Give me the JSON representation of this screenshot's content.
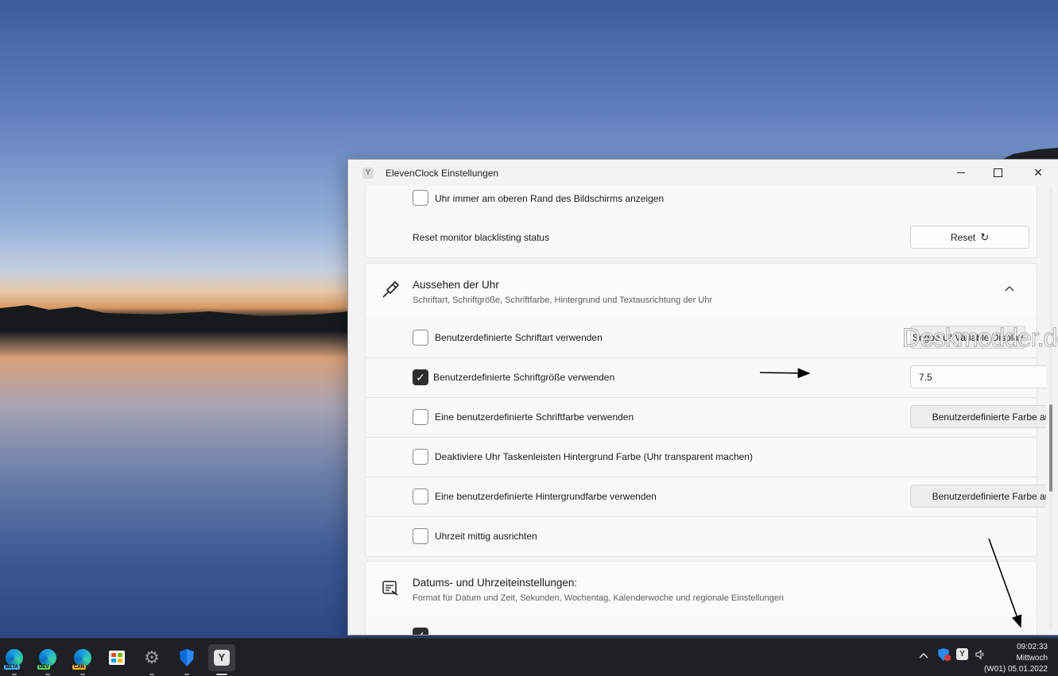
{
  "window": {
    "title": "ElevenClock Einstellungen",
    "app_icon_glyph": "Y"
  },
  "rows_top": [
    {
      "label": "Uhr immer am oberen Rand des Bildschirms anzeigen",
      "checked": false
    },
    {
      "label": "Reset monitor blacklisting status",
      "button": "Reset",
      "button_icon": "↻"
    }
  ],
  "section_appearance": {
    "title": "Aussehen der Uhr",
    "subtitle": "Schriftart, Schriftgröße, Schriftfarbe, Hintergrund und Textausrichtung der Uhr",
    "icon": "brush-icon",
    "collapse_glyph": "︿"
  },
  "appearance_rows": [
    {
      "label": "Benutzerdefinierte Schriftart verwenden",
      "checked": false,
      "button": "Segoe UI Variable Display"
    },
    {
      "label": "Benutzerdefinierte Schriftgröße verwenden",
      "checked": true,
      "select_value": "7.5"
    },
    {
      "label": "Eine benutzerdefinierte Schriftfarbe verwenden",
      "checked": false,
      "button": "Benutzerdefinierte Farbe auswählen"
    },
    {
      "label": "Deaktiviere Uhr Taskenleisten Hintergrund Farbe (Uhr transparent machen)",
      "checked": false
    },
    {
      "label": "Eine benutzerdefinierte Hintergrundfarbe verwenden",
      "checked": false,
      "button": "Benutzerdefinierte Farbe auswählen"
    },
    {
      "label": "Uhrzeit mittig ausrichten",
      "checked": false
    }
  ],
  "section_datetime": {
    "title": "Datums- und Uhrzeiteinstellungen:",
    "subtitle": "Format für Datum und Zeit, Sekunden, Wochentag, Kalenderwoche und regionale Einstellungen",
    "icon": "date-settings-icon"
  },
  "watermark": "Deskmodder.de",
  "taskbar": {
    "apps": [
      {
        "name": "edge-beta-icon",
        "badge": "BETA",
        "badge_color": "#4ab3f0"
      },
      {
        "name": "edge-dev-icon",
        "badge": "DEV",
        "badge_color": "#6ad06a"
      },
      {
        "name": "edge-canary-icon",
        "badge": "CAN",
        "badge_color": "#f0b030"
      },
      {
        "name": "store-icon"
      },
      {
        "name": "settings-icon"
      },
      {
        "name": "defender-icon"
      },
      {
        "name": "elevenclock-icon",
        "active": true
      }
    ],
    "clock": {
      "time": "09:02:33",
      "weekday": "Mittwoch",
      "date": "(W01) 05.01.2022"
    }
  },
  "colors": {
    "accent_check": "#2e2e2e",
    "taskbar_bg": "#1f2023",
    "window_bg": "#f3f3f3"
  }
}
